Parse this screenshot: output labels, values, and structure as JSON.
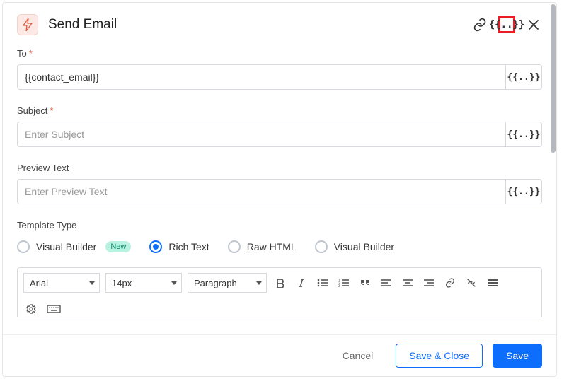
{
  "header": {
    "title": "Send Email"
  },
  "fields": {
    "to": {
      "label": "To",
      "required": "*",
      "value": "{{contact_email}}"
    },
    "subject": {
      "label": "Subject",
      "required": "*",
      "placeholder": "Enter Subject"
    },
    "preview": {
      "label": "Preview Text",
      "placeholder": "Enter Preview Text"
    },
    "templateType": {
      "label": "Template Type",
      "options": [
        {
          "label": "Visual Builder",
          "badge": "New",
          "selected": false
        },
        {
          "label": "Rich Text",
          "selected": true
        },
        {
          "label": "Raw HTML",
          "selected": false
        },
        {
          "label": "Visual Builder",
          "selected": false
        }
      ]
    }
  },
  "toolbar": {
    "font": "Arial",
    "size": "14px",
    "block": "Paragraph"
  },
  "footer": {
    "cancel": "Cancel",
    "saveClose": "Save & Close",
    "save": "Save"
  },
  "tokenGlyph": "{{..}}"
}
